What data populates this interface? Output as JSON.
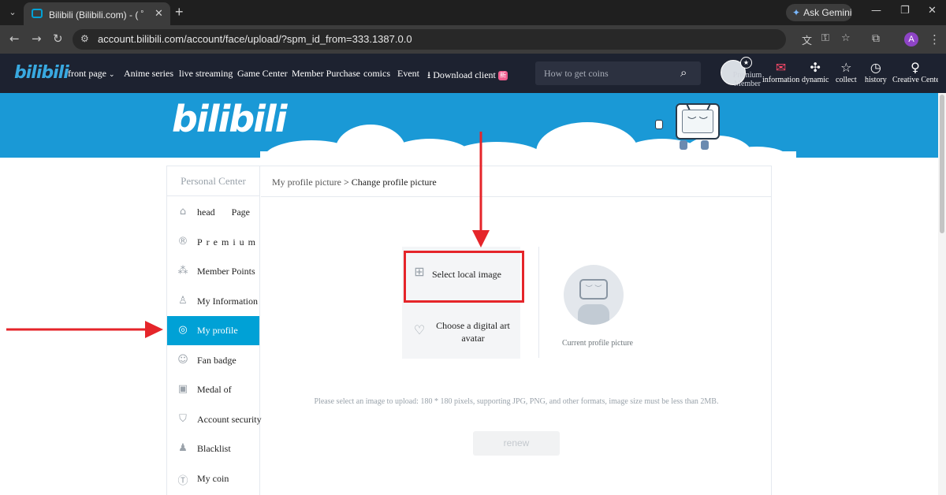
{
  "browser": {
    "tab_title": "Bilibili (Bilibili.com) - ( ゜- ゜)つロ 乾杯~",
    "tab_close": "✕",
    "new_tab": "+",
    "gemini_label": "Ask Gemini",
    "url": "account.bilibili.com/account/face/upload/?spm_id_from=333.1387.0.0",
    "profile_initial": "A"
  },
  "nav": {
    "logo": "bilibili",
    "items": [
      "front page",
      "Anime series",
      "live streaming",
      "Game Center",
      "Member Purchase",
      "comics",
      "Event"
    ],
    "download": "Download client",
    "download_badge": "新",
    "search_placeholder": "How to get coins",
    "user_label": "Premium Member",
    "tools": [
      "information",
      "dynamic",
      "collect",
      "history",
      "Creative Center"
    ]
  },
  "banner": {
    "logo": "bilibili",
    "tv_face": "︶ ︶"
  },
  "sidebar": {
    "title": "Personal Center",
    "items": [
      {
        "label": "head      Page",
        "icon": "home-icon"
      },
      {
        "label": "Premium",
        "icon": "premium-icon"
      },
      {
        "label": "Member Points",
        "icon": "points-icon"
      },
      {
        "label": "My Information",
        "icon": "person-icon"
      },
      {
        "label": "My profile",
        "icon": "profile-icon",
        "active": true
      },
      {
        "label": "Fan badge",
        "icon": "fan-badge-icon"
      },
      {
        "label": "Medal of",
        "icon": "medal-icon"
      },
      {
        "label": "Account security",
        "icon": "shield-icon"
      },
      {
        "label": "Blacklist",
        "icon": "blacklist-icon"
      },
      {
        "label": "My coin",
        "icon": "coin-icon"
      }
    ]
  },
  "content": {
    "breadcrumb_parent": "My profile picture",
    "breadcrumb_sep": " > ",
    "breadcrumb_current": "Change profile picture",
    "option_local": "Select local image",
    "option_digital": "Choose a digital art avatar",
    "current_label": "Current profile picture",
    "avatar_face": "︶ ︶",
    "hint": "Please select an image to upload: 180 * 180 pixels, supporting JPG, PNG, and other formats, image size must be less than 2MB.",
    "renew": "renew"
  },
  "colors": {
    "accent": "#00a1d6",
    "banner": "#1a99d6",
    "nav_bg": "#1d2230",
    "annotation": "#e5252a"
  }
}
